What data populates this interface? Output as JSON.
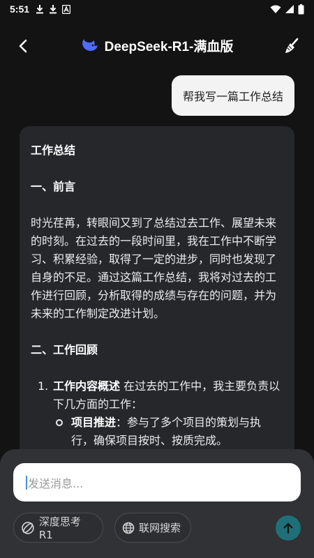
{
  "status_bar": {
    "time": "5:51",
    "left_icons": [
      "download-icon",
      "download-icon",
      "font-app-icon"
    ],
    "right_icons": [
      "wifi-icon",
      "signal-icon",
      "battery-icon"
    ]
  },
  "header": {
    "title": "DeepSeek-R1-满血版",
    "logo_icon": "deepseek-whale-icon",
    "back_icon": "chevron-left-icon",
    "action_icon": "broom-icon",
    "logo_color": "#4d6bfe"
  },
  "messages": {
    "user": "帮我写一篇工作总结",
    "ai": {
      "title": "工作总结",
      "section1_heading": "一、前言",
      "paragraph1": "时光荏苒，转眼间又到了总结过去工作、展望未来的时刻。在过去的一段时间里，我在工作中不断学习、积累经验，取得了一定的进步，同时也发现了自身的不足。通过这篇工作总结，我将对过去的工作进行回顾，分析取得的成绩与存在的问题，并为未来的工作制定改进计划。",
      "section2_heading": "二、工作回顾",
      "list_item1_num": "1.",
      "list_item1_bold": "工作内容概述",
      "list_item1_text": " 在过去的工作中，我主要负责以下几方面的工作：",
      "sub_item1_bold": "项目推进",
      "sub_item1_text": "：参与了多个项目的策划与执行，确保项目按时、按质完成。"
    }
  },
  "composer": {
    "placeholder": "发送消息...",
    "chip_think": "深度思考R1",
    "chip_search": "联网搜索",
    "send_icon": "arrow-up-icon",
    "send_color": "#1f6f78"
  }
}
